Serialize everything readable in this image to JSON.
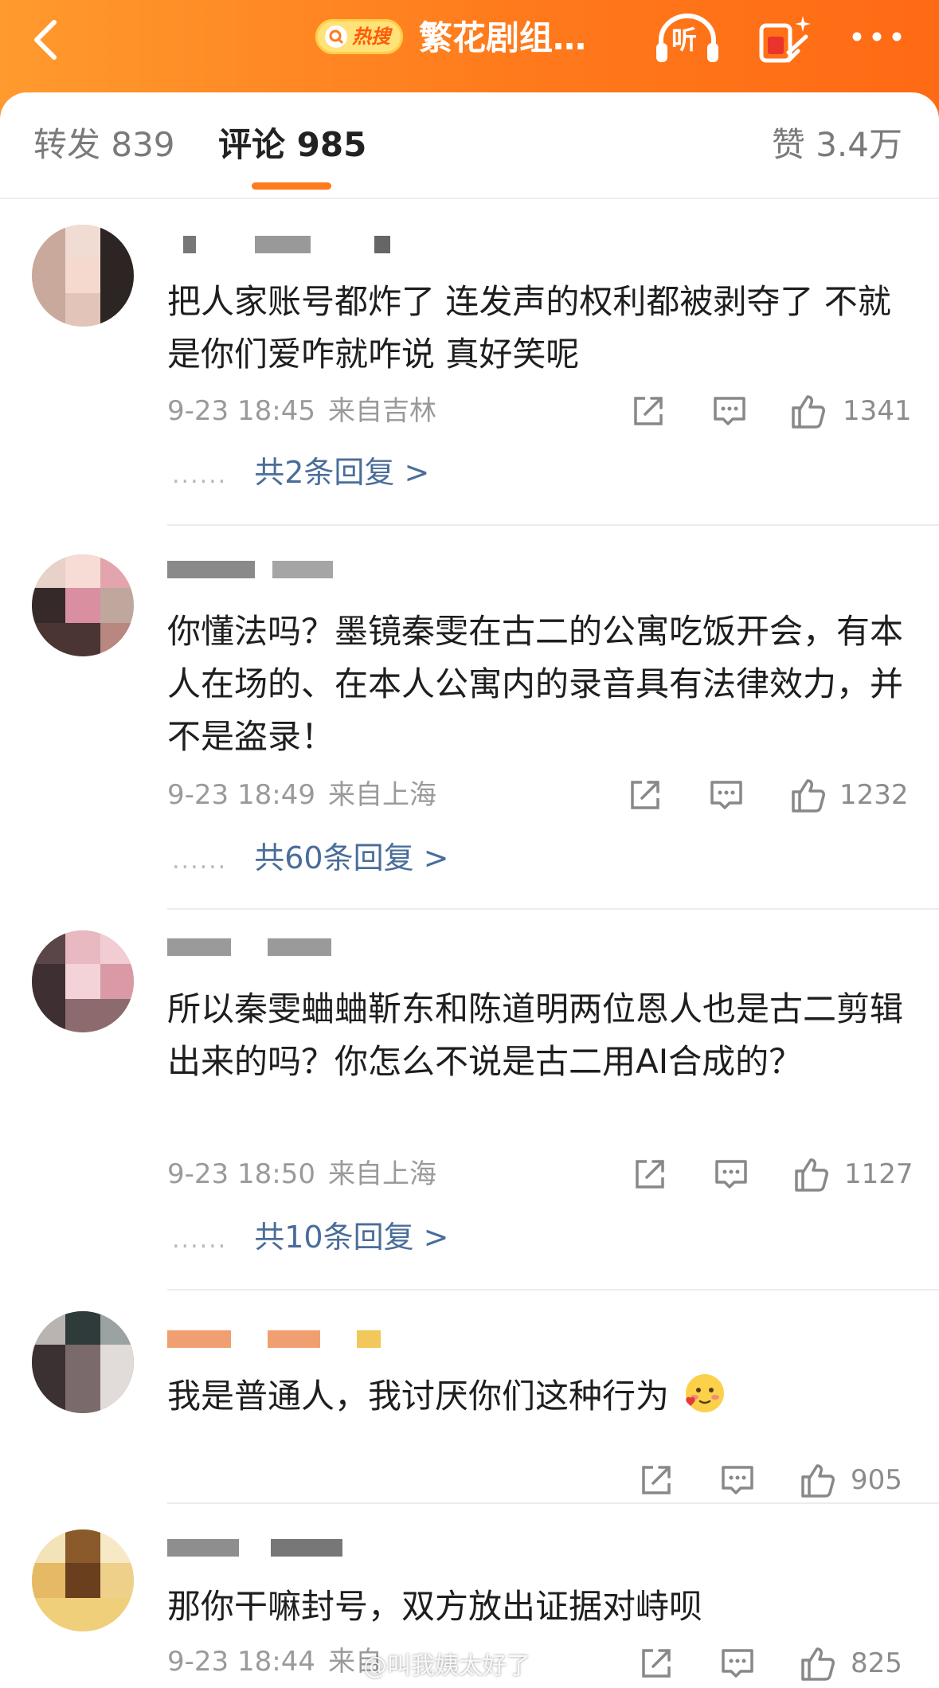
{
  "header": {
    "hot_badge": "热搜",
    "title": "繁花剧组…",
    "listen_label": "听"
  },
  "tabs": {
    "repost": "转发 839",
    "comment": "评论 985",
    "like": "赞 3.4万"
  },
  "comments": [
    {
      "content": "把人家账号都炸了 连发声的权利都被剥夺了 不就是你们爱咋就咋说 真好笑呢",
      "time": "9-23 18:45",
      "location": "来自吉林",
      "likes": "1341",
      "replies": "共2条回复 >"
    },
    {
      "content": "你懂法吗？墨镜秦雯在古二的公寓吃饭开会，有本人在场的、在本人公寓内的录音具有法律效力，并不是盗录！",
      "time": "9-23 18:49",
      "location": "来自上海",
      "likes": "1232",
      "replies": "共60条回复 >"
    },
    {
      "content": "所以秦雯蛐蛐靳东和陈道明两位恩人也是古二剪辑出来的吗？你怎么不说是古二用AI合成的？",
      "time": "9-23 18:50",
      "location": "来自上海",
      "likes": "1127",
      "replies": "共10条回复 >"
    },
    {
      "content": "我是普通人，我讨厌你们这种行为",
      "likes": "905"
    },
    {
      "content": "那你干嘛封号，双方放出证据对峙呗",
      "time": "9-23 18:44",
      "location": "来自",
      "likes": "825"
    }
  ],
  "watermark": "@叫我姨太好了",
  "colors": {
    "header_gradient_start": "#ff9a2e",
    "header_gradient_end": "#ff6a14",
    "tab_underline": "#ff7a1c",
    "reply_link": "#4a6d9a"
  },
  "icons": [
    "back-icon",
    "search-icon",
    "headphones-icon",
    "magic-icon",
    "more-icon",
    "share-icon",
    "comment-icon",
    "thumbs-up-icon",
    "blush-emoji-icon"
  ]
}
